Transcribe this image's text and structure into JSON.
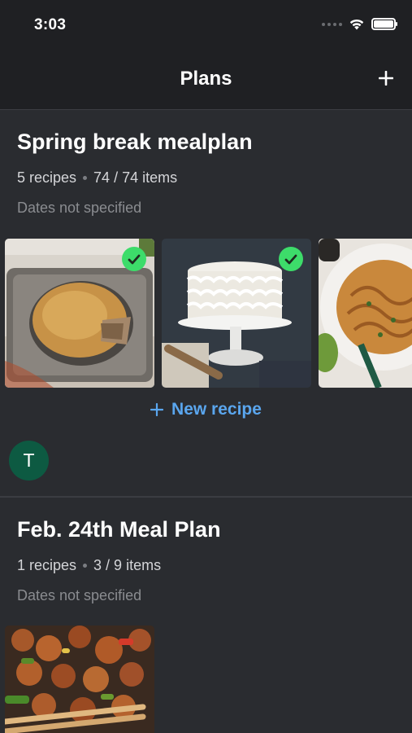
{
  "status_bar": {
    "time": "3:03"
  },
  "header": {
    "title": "Plans"
  },
  "plans": [
    {
      "title": "Spring break mealplan",
      "recipes": "5 recipes",
      "items": "74 / 74 items",
      "dates": "Dates not specified",
      "new_recipe_label": "New recipe",
      "member_initial": "T",
      "photos": [
        {
          "subject": "pot pie on baking tray",
          "checked": true
        },
        {
          "subject": "white frosted cake on stand",
          "checked": true
        },
        {
          "subject": "pasta dish",
          "checked": false
        }
      ]
    },
    {
      "title": "Feb. 24th Meal Plan",
      "recipes": "1 recipes",
      "items": "3 / 9 items",
      "dates": "Dates not specified",
      "photos": [
        {
          "subject": "stir fry chicken with chopsticks",
          "checked": false
        }
      ]
    }
  ],
  "colors": {
    "accent": "#5aa6ee",
    "check": "#3ddc6a",
    "background": "#2a2c30",
    "avatar": "#0d5a42"
  }
}
